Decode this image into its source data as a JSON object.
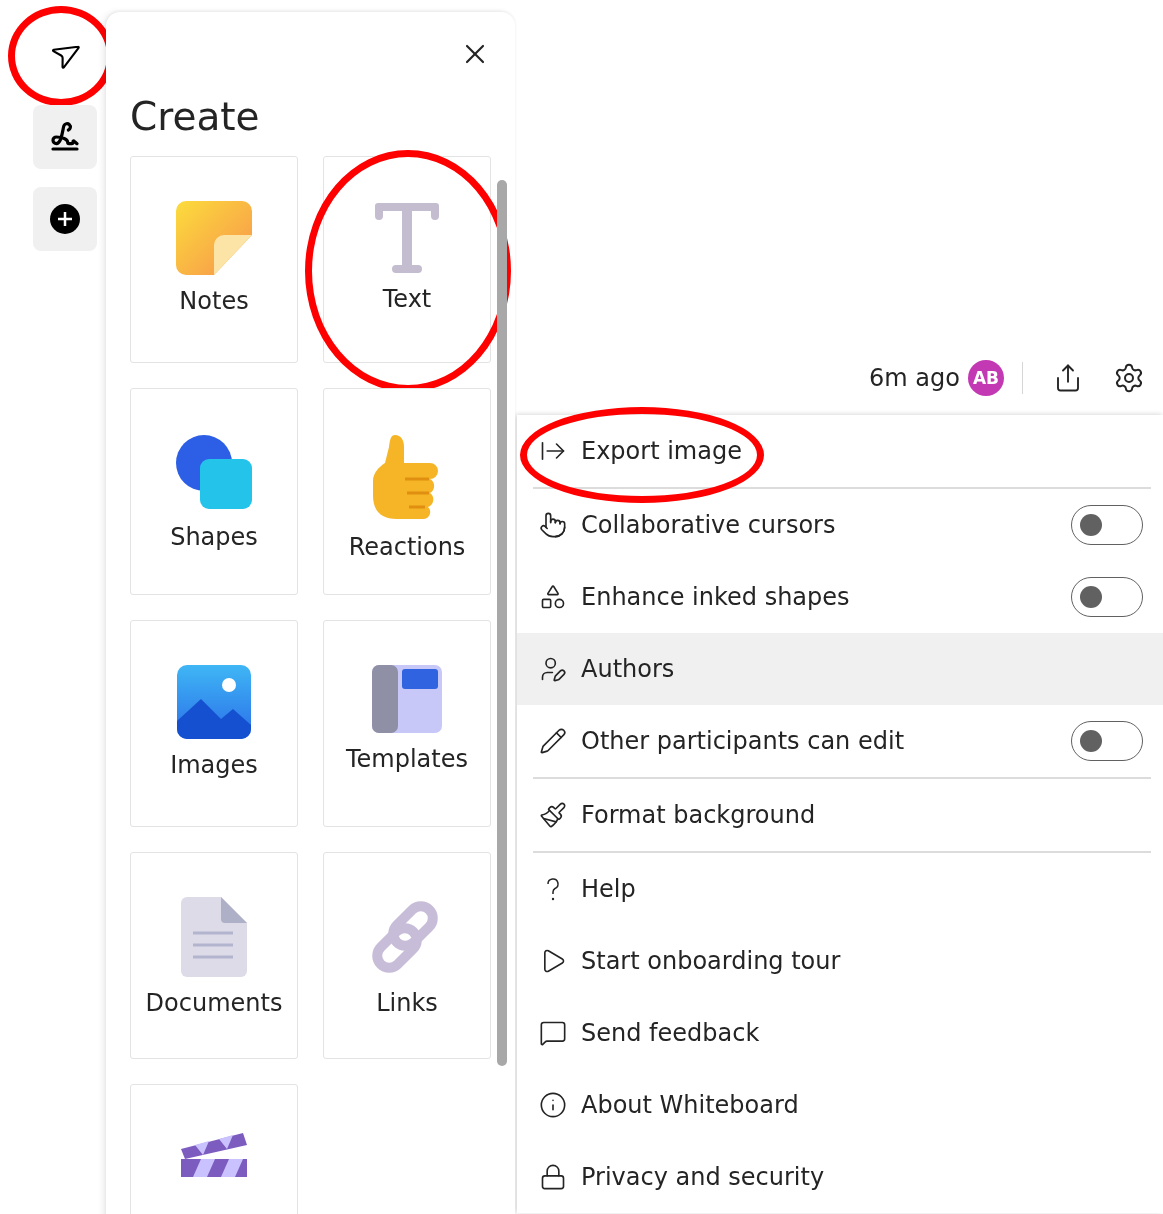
{
  "tools": [
    {
      "kind": "pointer",
      "circled": true
    },
    {
      "kind": "pen",
      "circled": false
    },
    {
      "kind": "add",
      "circled": false
    }
  ],
  "panel": {
    "title": "Create",
    "tiles": [
      {
        "label": "Notes",
        "circled": false
      },
      {
        "label": "Text",
        "circled": true
      },
      {
        "label": "Shapes",
        "circled": false
      },
      {
        "label": "Reactions",
        "circled": false
      },
      {
        "label": "Images",
        "circled": false
      },
      {
        "label": "Templates",
        "circled": false
      },
      {
        "label": "Documents",
        "circled": false
      },
      {
        "label": "Links",
        "circled": false
      },
      {
        "circled": false
      }
    ]
  },
  "header": {
    "saved": "6m ago",
    "avatar": "AB"
  },
  "menu": [
    [
      {
        "kind": "action",
        "label": "Export image",
        "selected": false,
        "circled": true
      }
    ],
    [
      {
        "kind": "toggle",
        "label": "Collaborative cursors",
        "on": false,
        "selected": false,
        "circled": false
      },
      {
        "kind": "toggle",
        "label": "Enhance inked shapes",
        "on": false,
        "selected": false,
        "circled": false
      },
      {
        "kind": "action",
        "label": "Authors",
        "selected": true,
        "circled": false
      },
      {
        "kind": "toggle",
        "label": "Other participants can edit",
        "on": false,
        "selected": false,
        "circled": false
      }
    ],
    [
      {
        "kind": "action",
        "label": "Format background",
        "selected": false,
        "circled": false
      }
    ],
    [
      {
        "kind": "action",
        "label": "Help",
        "selected": false,
        "circled": false
      },
      {
        "kind": "action",
        "label": "Start onboarding tour",
        "selected": false,
        "circled": false
      },
      {
        "kind": "action",
        "label": "Send feedback",
        "selected": false,
        "circled": false
      },
      {
        "kind": "action",
        "label": "About Whiteboard",
        "selected": false,
        "circled": false
      },
      {
        "kind": "action",
        "label": "Privacy and security",
        "selected": false,
        "circled": false
      }
    ]
  ]
}
